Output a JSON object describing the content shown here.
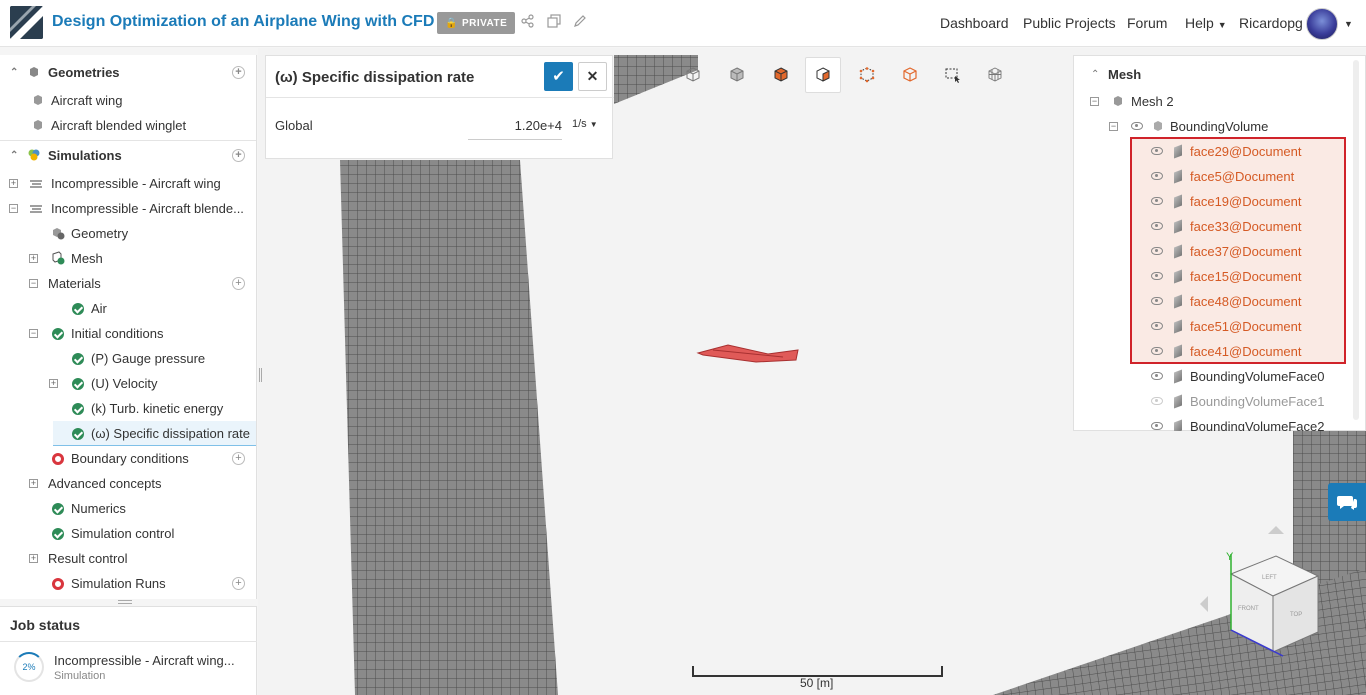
{
  "header": {
    "title": "Design Optimization of an Airplane Wing with CFD",
    "private_label": "PRIVATE",
    "nav": {
      "dashboard": "Dashboard",
      "public_projects": "Public Projects",
      "forum": "Forum",
      "help": "Help",
      "user": "Ricardopg"
    }
  },
  "tree": {
    "geometries": "Geometries",
    "geometry_items": [
      "Aircraft wing",
      "Aircraft blended winglet"
    ],
    "simulations": "Simulations",
    "sim1": "Incompressible - Aircraft wing",
    "sim2": "Incompressible - Aircraft blende...",
    "geometry": "Geometry",
    "mesh": "Mesh",
    "materials": "Materials",
    "air": "Air",
    "initial_conditions": "Initial conditions",
    "gauge_pressure": "(P) Gauge pressure",
    "velocity": "(U) Velocity",
    "tke": "(k) Turb. kinetic energy",
    "sdr": "(ω) Specific dissipation rate",
    "boundary_conditions": "Boundary conditions",
    "advanced_concepts": "Advanced concepts",
    "numerics": "Numerics",
    "simulation_control": "Simulation control",
    "result_control": "Result control",
    "simulation_runs": "Simulation Runs"
  },
  "job": {
    "title": "Job status",
    "progress": "2%",
    "name": "Incompressible - Aircraft wing...",
    "type": "Simulation"
  },
  "property": {
    "title": "(ω) Specific dissipation rate",
    "label": "Global",
    "value": "1.20e+4",
    "unit": "1/s"
  },
  "scene": {
    "root": "Mesh",
    "mesh2": "Mesh 2",
    "bounding_volume": "BoundingVolume",
    "faces": [
      "face29@Document",
      "face5@Document",
      "face19@Document",
      "face33@Document",
      "face37@Document",
      "face15@Document",
      "face48@Document",
      "face51@Document",
      "face41@Document"
    ],
    "bv_faces": [
      "BoundingVolumeFace0",
      "BoundingVolumeFace1",
      "BoundingVolumeFace2"
    ]
  },
  "viewport": {
    "scale_label": "50 [m]",
    "axis_y": "Y",
    "cube_faces": [
      "LEFT",
      "FRONT",
      "TOP"
    ]
  },
  "colors": {
    "brand": "#1b7bb8",
    "selected_face": "#d55a24",
    "selection_border": "#d0232a",
    "ok": "#2e8b57",
    "error": "#d9363e"
  }
}
